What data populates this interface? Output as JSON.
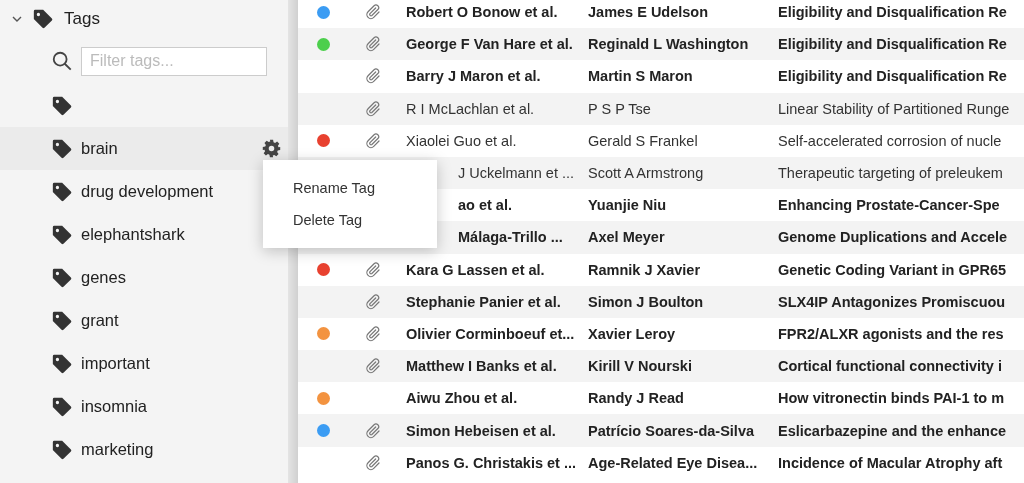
{
  "sidebar": {
    "section": {
      "label": "Tags",
      "expanded": true
    },
    "filter": {
      "placeholder": "Filter tags..."
    },
    "tags": [
      {
        "selected": false
      },
      {
        "label": "brain",
        "selected": true
      },
      {
        "label": "drug development",
        "selected": false
      },
      {
        "label": "elephantshark",
        "selected": false
      },
      {
        "label": "genes",
        "selected": false
      },
      {
        "label": "grant",
        "selected": false
      },
      {
        "label": "important",
        "selected": false
      },
      {
        "label": "insomnia",
        "selected": false
      },
      {
        "label": "marketing",
        "selected": false
      }
    ]
  },
  "context_menu": {
    "items": [
      "Rename Tag",
      "Delete Tag"
    ]
  },
  "table": {
    "rows": [
      {
        "color": "#3b9cf3",
        "attachment": true,
        "unread": true,
        "first_author": "Robert O Bonow et al.",
        "last_author": "James E Udelson",
        "title": "Eligibility and Disqualification Re"
      },
      {
        "color": "#4ccf4c",
        "attachment": true,
        "unread": true,
        "first_author": "George F Van Hare et al.",
        "last_author": "Reginald L Washington",
        "title": "Eligibility and Disqualification Re"
      },
      {
        "attachment": true,
        "unread": true,
        "first_author": "Barry J Maron et al.",
        "last_author": "Martin S Maron",
        "title": "Eligibility and Disqualification Re"
      },
      {
        "attachment": true,
        "unread": false,
        "first_author": "R I McLachlan et al.",
        "last_author": "P S P Tse",
        "title": "Linear Stability of Partitioned Runge"
      },
      {
        "color": "#e8412f",
        "attachment": true,
        "unread": false,
        "first_author": "Xiaolei Guo et al.",
        "last_author": "Gerald S Frankel",
        "title": "Self-accelerated corrosion of nucle"
      },
      {
        "covered": true,
        "unread": false,
        "first_author": "J Uckelmann et ...",
        "last_author": "Scott A Armstrong",
        "title": "Therapeutic targeting of preleukem"
      },
      {
        "covered": true,
        "unread": true,
        "first_author": "ao et al.",
        "last_author": "Yuanjie Niu",
        "title": "Enhancing Prostate-Cancer-Spe"
      },
      {
        "covered": true,
        "unread": true,
        "first_author": "Málaga-Trillo ...",
        "last_author": "Axel Meyer",
        "title": "Genome Duplications and Accele"
      },
      {
        "color": "#e8412f",
        "attachment": true,
        "unread": true,
        "first_author": "Kara G Lassen et al.",
        "last_author": "Ramnik J Xavier",
        "title": "Genetic Coding Variant in GPR65"
      },
      {
        "attachment": true,
        "unread": true,
        "first_author": "Stephanie Panier et al.",
        "last_author": "Simon J Boulton",
        "title": "SLX4IP Antagonizes Promiscuou"
      },
      {
        "color": "#f39340",
        "attachment": true,
        "unread": true,
        "first_author": "Olivier Corminboeuf et...",
        "last_author": "Xavier Leroy",
        "title": "FPR2/ALXR agonists and the res"
      },
      {
        "attachment": true,
        "unread": true,
        "first_author": "Matthew I Banks et al.",
        "last_author": "Kirill V Nourski",
        "title": "Cortical functional connectivity i"
      },
      {
        "color": "#f39340",
        "attachment": false,
        "unread": true,
        "first_author": "Aiwu Zhou et al.",
        "last_author": "Randy J Read",
        "title": "How vitronectin binds PAI-1 to m"
      },
      {
        "color": "#3b9cf3",
        "attachment": true,
        "unread": true,
        "first_author": "Simon Hebeisen et al.",
        "last_author": "Patrício Soares-da-Silva",
        "title": "Eslicarbazepine and the enhance"
      },
      {
        "attachment": true,
        "unread": true,
        "first_author": "Panos G. Christakis et ...",
        "last_author": "Age-Related Eye Disea...",
        "title": "Incidence of Macular Atrophy aft"
      }
    ]
  }
}
